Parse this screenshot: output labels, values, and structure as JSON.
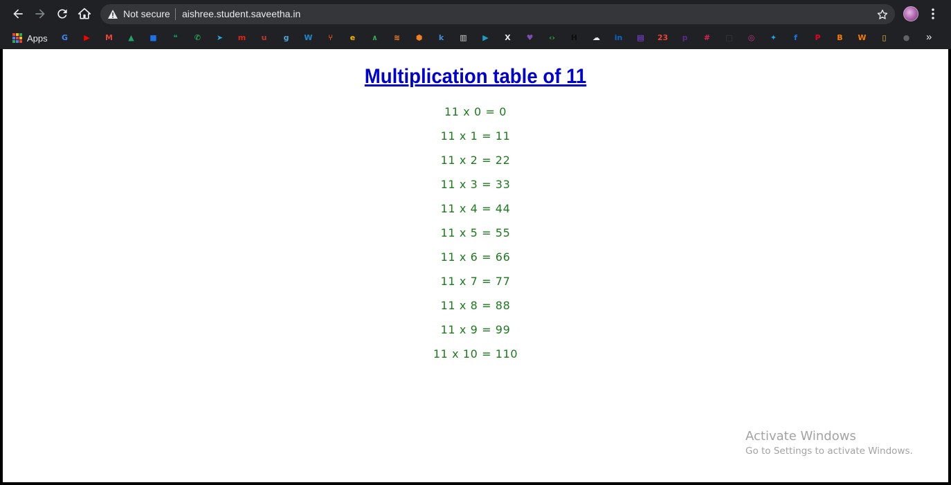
{
  "browser": {
    "security_label": "Not secure",
    "url": "aishree.student.saveetha.in",
    "apps_label": "Apps",
    "more_bookmarks_glyph": "»"
  },
  "bookmarks": [
    {
      "name": "google",
      "glyph": "G",
      "color": "#4285f4"
    },
    {
      "name": "youtube",
      "glyph": "▶",
      "color": "#ff0000"
    },
    {
      "name": "gmail",
      "glyph": "M",
      "color": "#ea4335"
    },
    {
      "name": "drive",
      "glyph": "▲",
      "color": "#1fa463"
    },
    {
      "name": "meet",
      "glyph": "■",
      "color": "#1a73e8"
    },
    {
      "name": "hangouts",
      "glyph": "❝",
      "color": "#0f9d58"
    },
    {
      "name": "whatsapp",
      "glyph": "✆",
      "color": "#25d366"
    },
    {
      "name": "telegram",
      "glyph": "➤",
      "color": "#2aa3df"
    },
    {
      "name": "m-app",
      "glyph": "m",
      "color": "#e2231a"
    },
    {
      "name": "u-app",
      "glyph": "u",
      "color": "#c0392b"
    },
    {
      "name": "g-app",
      "glyph": "g",
      "color": "#4fa3d1"
    },
    {
      "name": "w-app",
      "glyph": "W",
      "color": "#1e88c7"
    },
    {
      "name": "fork-app",
      "glyph": "⑂",
      "color": "#e84e1b"
    },
    {
      "name": "coin-app",
      "glyph": "e",
      "color": "#f4b400"
    },
    {
      "name": "peaks-app",
      "glyph": "∧",
      "color": "#34a853"
    },
    {
      "name": "stack-app",
      "glyph": "≋",
      "color": "#f48024"
    },
    {
      "name": "cube-app",
      "glyph": "⬢",
      "color": "#f38020"
    },
    {
      "name": "k-app",
      "glyph": "k",
      "color": "#3f8ed8"
    },
    {
      "name": "chart-app",
      "glyph": "▥",
      "color": "#cfcfcf"
    },
    {
      "name": "play-app",
      "glyph": "▶",
      "color": "#18a0c8"
    },
    {
      "name": "x-app",
      "glyph": "X",
      "color": "#e8eaed"
    },
    {
      "name": "shield-app",
      "glyph": "♥",
      "color": "#7b4db0"
    },
    {
      "name": "code-app",
      "glyph": "‹›",
      "color": "#2e9e3e"
    },
    {
      "name": "hr-app",
      "glyph": "H",
      "color": "#0e0e0e"
    },
    {
      "name": "cloud-app",
      "glyph": "☁",
      "color": "#e8eaed"
    },
    {
      "name": "linkedin",
      "glyph": "in",
      "color": "#0a66c2"
    },
    {
      "name": "twitch",
      "glyph": "▤",
      "color": "#9146ff"
    },
    {
      "name": "calendar",
      "glyph": "23",
      "color": "#ea4335"
    },
    {
      "name": "p-app",
      "glyph": "p",
      "color": "#5b2a86"
    },
    {
      "name": "slack",
      "glyph": "#",
      "color": "#e01e5a"
    },
    {
      "name": "box-app",
      "glyph": "□",
      "color": "#3c3c3c"
    },
    {
      "name": "instagram",
      "glyph": "◎",
      "color": "#c13584"
    },
    {
      "name": "twitter",
      "glyph": "✦",
      "color": "#1da1f2"
    },
    {
      "name": "facebook",
      "glyph": "f",
      "color": "#1877f2"
    },
    {
      "name": "pinterest",
      "glyph": "P",
      "color": "#e60023"
    },
    {
      "name": "blogger",
      "glyph": "B",
      "color": "#f57d00"
    },
    {
      "name": "w-orange-app",
      "glyph": "W",
      "color": "#f57c00"
    },
    {
      "name": "phone-app",
      "glyph": "▯",
      "color": "#f5c542"
    },
    {
      "name": "github",
      "glyph": "●",
      "color": "#5f6368"
    }
  ],
  "page": {
    "title": "Multiplication table of 11",
    "lines": [
      "11 x 0 = 0",
      "11 x 1 = 11",
      "11 x 2 = 22",
      "11 x 3 = 33",
      "11 x 4 = 44",
      "11 x 5 = 55",
      "11 x 6 = 66",
      "11 x 7 = 77",
      "11 x 8 = 88",
      "11 x 9 = 99",
      "11 x 10 = 110"
    ]
  },
  "watermark": {
    "title": "Activate Windows",
    "subtitle": "Go to Settings to activate Windows."
  },
  "colors": {
    "title": "#0000cd",
    "lines": "#1b7a1b",
    "chrome_bg": "#202124"
  }
}
